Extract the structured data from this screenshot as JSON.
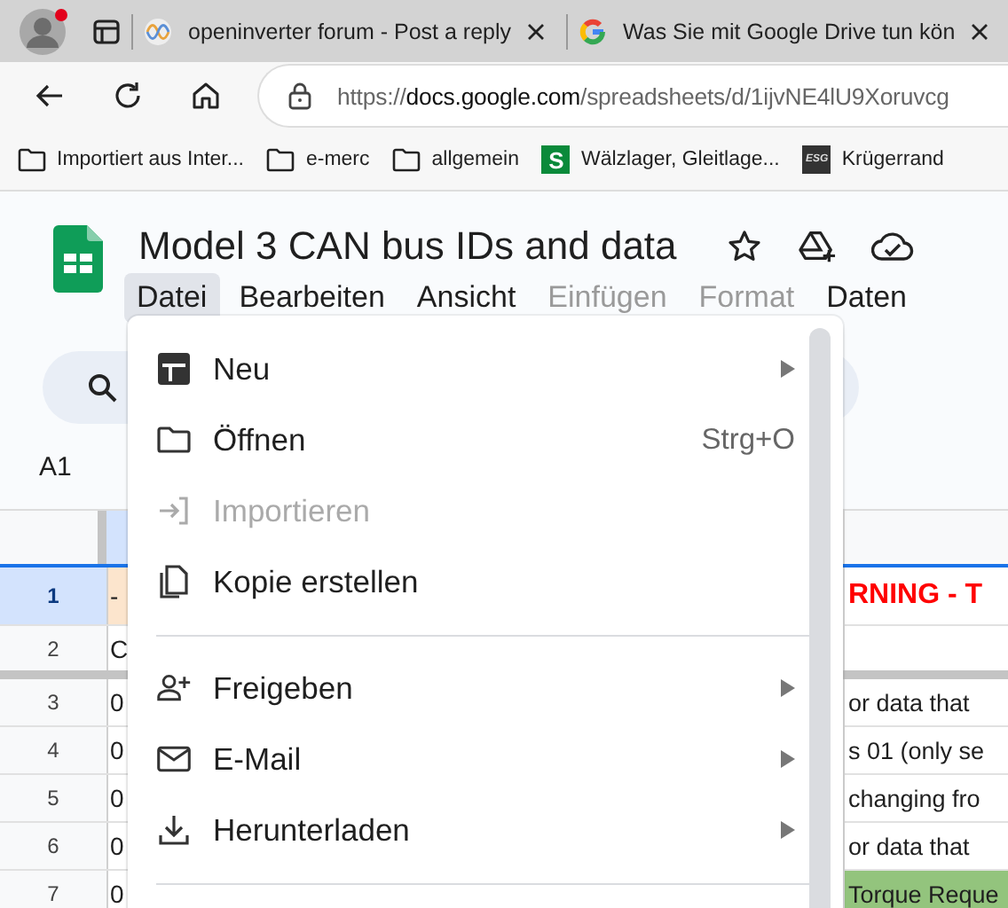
{
  "browser": {
    "profile": {
      "notification": true
    },
    "tabs": [
      {
        "title": "openinverter forum - Post a reply",
        "selected": false
      },
      {
        "title": "Was Sie mit Google Drive tun kön",
        "selected": false
      }
    ],
    "address": {
      "scheme": "https://",
      "host": "docs.google.com",
      "path": "/spreadsheets/d/1ijvNE4lU9Xoruvcg"
    },
    "bookmarks": [
      {
        "kind": "folder",
        "label": "Importiert aus Inter..."
      },
      {
        "kind": "folder",
        "label": "e-merc"
      },
      {
        "kind": "folder",
        "label": "allgemein"
      },
      {
        "kind": "letter",
        "favicon_text": "S",
        "label": "Wälzlager, Gleitlage..."
      },
      {
        "kind": "dark",
        "favicon_text": "ESG",
        "label": "Krügerrand"
      }
    ]
  },
  "document": {
    "title": "Model 3 CAN bus IDs and data",
    "menu": [
      {
        "label": "Datei",
        "selected": true,
        "disabled": false
      },
      {
        "label": "Bearbeiten",
        "selected": false,
        "disabled": false
      },
      {
        "label": "Ansicht",
        "selected": false,
        "disabled": false
      },
      {
        "label": "Einfügen",
        "selected": false,
        "disabled": true
      },
      {
        "label": "Format",
        "selected": false,
        "disabled": true
      },
      {
        "label": "Daten",
        "selected": false,
        "disabled": false
      }
    ]
  },
  "name_box": "A1",
  "sheet": {
    "rows": [
      {
        "number": "1",
        "selected": true,
        "cell_a": {
          "text": "-",
          "color": "#fce5cd"
        },
        "cell_c": {
          "text": "RNING - T",
          "emphasis": true
        }
      },
      {
        "number": "2",
        "selected": false,
        "cell_a": {
          "text": "C"
        }
      },
      {
        "number": "3",
        "selected": false,
        "cell_a": {
          "text": "0"
        },
        "cell_c": {
          "text": "or data that",
          "emphasis": false
        }
      },
      {
        "number": "4",
        "selected": false,
        "cell_a": {
          "text": "0"
        },
        "cell_c": {
          "text": "s 01 (only se",
          "emphasis": false
        }
      },
      {
        "number": "5",
        "selected": false,
        "cell_a": {
          "text": "0"
        },
        "cell_c": {
          "text": "changing fro",
          "emphasis": false
        }
      },
      {
        "number": "6",
        "selected": false,
        "cell_a": {
          "text": "0"
        },
        "cell_c": {
          "text": "or data that",
          "emphasis": false
        }
      },
      {
        "number": "7",
        "selected": false,
        "cell_a": {
          "text": "0"
        },
        "cell_c": {
          "text": "Torque Reque",
          "emphasis": false,
          "color": "#93c47d"
        }
      }
    ]
  },
  "file_menu": {
    "sections": [
      {
        "items": [
          {
            "label": "Neu",
            "disabled": false,
            "submenu": true
          },
          {
            "label": "Öffnen",
            "disabled": false,
            "submenu": false,
            "shortcut": "Strg+O"
          },
          {
            "label": "Importieren",
            "disabled": true,
            "submenu": false
          },
          {
            "label": "Kopie erstellen",
            "disabled": false,
            "submenu": false
          }
        ]
      },
      {
        "items": [
          {
            "label": "Freigeben",
            "disabled": false,
            "submenu": true
          },
          {
            "label": "E-Mail",
            "disabled": false,
            "submenu": true
          },
          {
            "label": "Herunterladen",
            "disabled": false,
            "submenu": true
          }
        ]
      }
    ]
  }
}
